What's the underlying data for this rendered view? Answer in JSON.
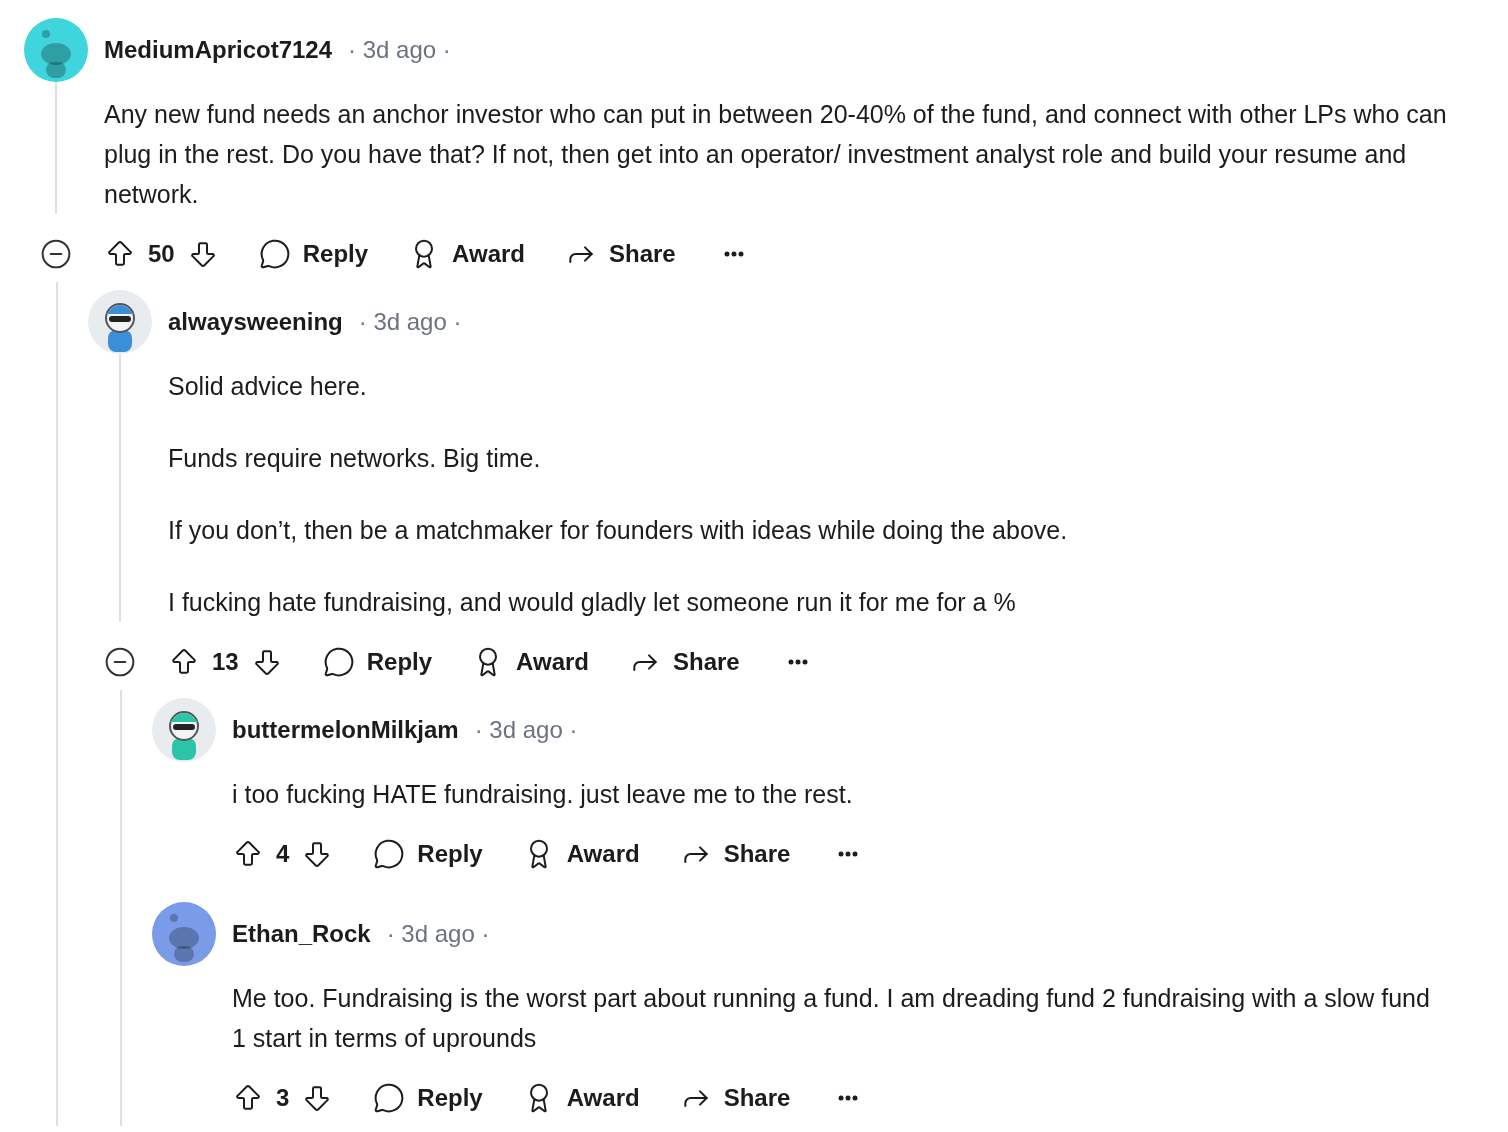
{
  "comments": [
    {
      "author": "MediumApricot7124",
      "time": "· 3d ago ·",
      "avatar": {
        "kind": "snoo",
        "color": "#3fd5dd"
      },
      "body": [
        "Any new fund needs an anchor investor who can put in between 20-40% of the fund, and connect with other LPs who can plug in the rest. Do you have that? If not, then get into an operator/ investment analyst role and build your resume and network."
      ],
      "votes": "50",
      "actions": [
        "Reply",
        "Award",
        "Share"
      ],
      "expanded": true,
      "children": [
        {
          "author": "alwaysweening",
          "time": "· 3d ago ·",
          "avatar": {
            "kind": "custom",
            "color": "#3b8fd9"
          },
          "body": [
            "Solid advice here.",
            "Funds require networks. Big time.",
            "If you don’t, then be a matchmaker for founders with ideas while doing the above.",
            "I fucking hate fundraising, and would gladly let someone run it for me for a %"
          ],
          "votes": "13",
          "actions": [
            "Reply",
            "Award",
            "Share"
          ],
          "expanded": true,
          "children": [
            {
              "author": "buttermelonMilkjam",
              "time": "· 3d ago ·",
              "avatar": {
                "kind": "custom",
                "color": "#2cc4a8"
              },
              "body": [
                "i too fucking HATE fundraising. just leave me to the rest."
              ],
              "votes": "4",
              "actions": [
                "Reply",
                "Award",
                "Share"
              ]
            },
            {
              "author": "Ethan_Rock",
              "time": "· 3d ago ·",
              "avatar": {
                "kind": "snoo",
                "color": "#7a9ce8"
              },
              "body": [
                "Me too. Fundraising is the worst part about running a fund. I am dreading fund 2 fundraising with a slow fund 1 start in terms of uprounds"
              ],
              "votes": "3",
              "actions": [
                "Reply",
                "Award",
                "Share"
              ]
            }
          ]
        }
      ]
    }
  ]
}
